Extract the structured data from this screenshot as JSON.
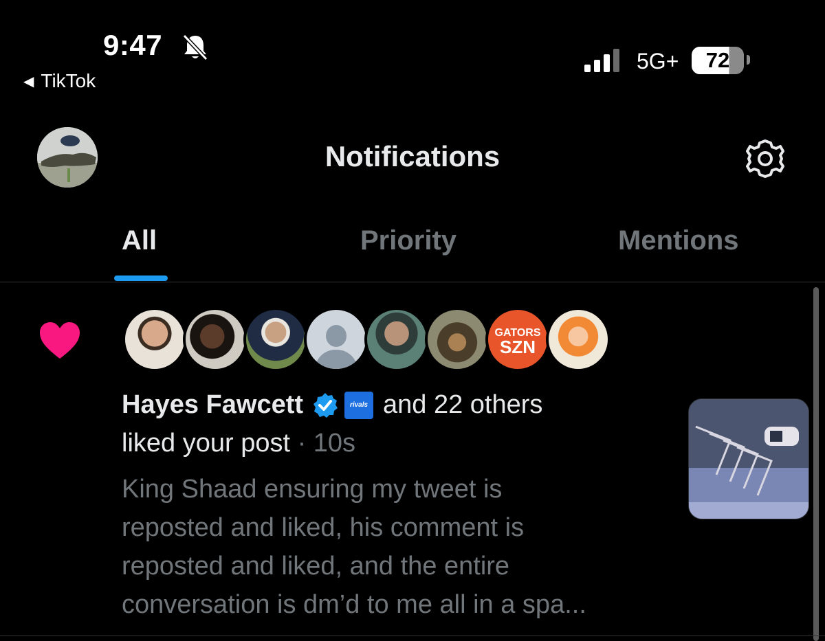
{
  "status_bar": {
    "time": "9:47",
    "back_app": "TikTok",
    "network": "5G+",
    "battery": "72"
  },
  "header": {
    "title": "Notifications"
  },
  "tabs": [
    {
      "label": "All",
      "active": true
    },
    {
      "label": "Priority",
      "active": false
    },
    {
      "label": "Mentions",
      "active": false
    }
  ],
  "notification": {
    "type_icon": "heart-icon",
    "actor": "Hayes Fawcett",
    "affiliate_badge": "rivals",
    "others": "and 22 others",
    "action": "liked your post",
    "time": "· 10s",
    "preview_lines": [
      "King Shaad ensuring my tweet is",
      "reposted and liked, his comment is",
      "reposted and liked, and the entire",
      "conversation is dm’d to me all in a spa..."
    ],
    "avatar_texts": {
      "gators_line1": "GATORS",
      "gators_line2": "SZN"
    }
  },
  "colors": {
    "accent": "#1d9bf0",
    "like": "#f91880",
    "muted": "#71767b"
  }
}
